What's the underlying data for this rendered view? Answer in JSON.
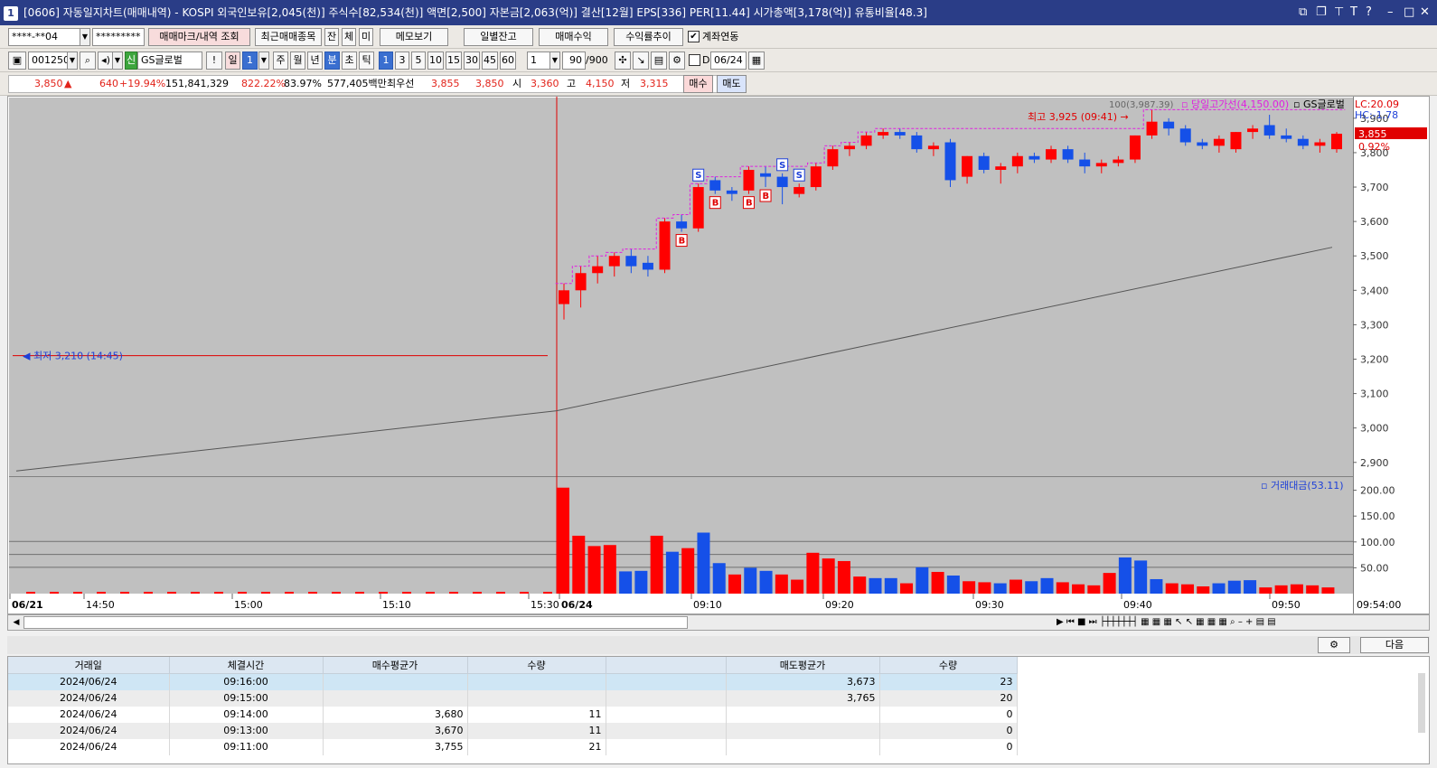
{
  "title": {
    "num": "1",
    "text": "[0606] 자동일지차트(매매내역) - KOSPI 외국인보유[2,045(천)] 주식수[82,534(천)] 액면[2,500] 자본금[2,063(억)] 결산[12월] EPS[336] PER[11.44] 시가총액[3,178(억)] 유통비율[48.3]"
  },
  "toolbar1": {
    "account": "****-**04",
    "password": "*********",
    "btn_mark": "매매마크/내역 조회",
    "btn_recent": "최근매매종목",
    "btn_jan": "잔",
    "btn_che": "체",
    "btn_mi": "미",
    "btn_memo": "메모보기",
    "btn_daily": "일별잔고",
    "btn_profit": "매매수익",
    "btn_rate": "수익률추이",
    "link_label": "계좌연동"
  },
  "toolbar2": {
    "code": "001250",
    "badge": "신",
    "name": "GS글로벌",
    "excl": "!",
    "day": "일",
    "day_num": "1",
    "periods": [
      "주",
      "월",
      "년",
      "분",
      "초",
      "틱"
    ],
    "intervals": [
      "1",
      "3",
      "5",
      "10",
      "15",
      "30",
      "45",
      "60"
    ],
    "interval_val": "1",
    "count": "90",
    "count_max": "/900",
    "date_chk": "D",
    "date": "06/24"
  },
  "quote": {
    "price": "3,850",
    "arrow": "▲",
    "change": "640",
    "change_pct": "+19.94%",
    "volume": "151,841,329",
    "vol_pct": "822.22%",
    "rate2": "83.97%",
    "amount": "577,405백만",
    "best_label": "최우선",
    "ask": "3,855",
    "bid": "3,850",
    "open_label": "시",
    "open": "3,360",
    "high_label": "고",
    "high": "4,150",
    "low_label": "저",
    "low": "3,315",
    "buy_btn": "매수",
    "sell_btn": "매도"
  },
  "chart_labels": {
    "legend_ma": "100(3,987.39)",
    "legend_high": "당일고가선(4,150.00)",
    "legend_name": "GS글로벌",
    "lc": "LC:20.09",
    "hc": "HC:-1.78",
    "last_price": "3,855",
    "last_pct": "0.92%",
    "low_note": "최저 3,210 (14:45)",
    "high_note": "최고 3,925 (09:41)",
    "vol_legend": "거래대금(53.11)",
    "time_end": "09:54:00"
  },
  "chart_data": {
    "type": "candlestick",
    "price_axis": {
      "ticks": [
        "3,900",
        "3,800",
        "3,700",
        "3,600",
        "3,500",
        "3,400",
        "3,300",
        "3,200",
        "3,100",
        "3,000",
        "2,900"
      ],
      "range": [
        2860,
        3960
      ]
    },
    "volume_axis": {
      "ticks": [
        "200.00",
        "150.00",
        "100.00",
        "50.00"
      ],
      "range": [
        0,
        215
      ]
    },
    "x_labels": [
      "06/21",
      "14:50",
      "15:00",
      "15:10",
      "15:30",
      "06/24",
      "09:10",
      "09:20",
      "09:30",
      "09:40",
      "09:50"
    ],
    "candles": [
      [
        3360,
        3420,
        3315,
        3400
      ],
      [
        3400,
        3470,
        3350,
        3450
      ],
      [
        3450,
        3500,
        3420,
        3470
      ],
      [
        3470,
        3510,
        3440,
        3500
      ],
      [
        3500,
        3520,
        3450,
        3470
      ],
      [
        3480,
        3500,
        3440,
        3460
      ],
      [
        3460,
        3610,
        3450,
        3600
      ],
      [
        3600,
        3620,
        3570,
        3580
      ],
      [
        3580,
        3710,
        3570,
        3700
      ],
      [
        3720,
        3730,
        3680,
        3690
      ],
      [
        3690,
        3700,
        3660,
        3680
      ],
      [
        3690,
        3760,
        3680,
        3750
      ],
      [
        3740,
        3760,
        3700,
        3730
      ],
      [
        3730,
        3740,
        3650,
        3700
      ],
      [
        3680,
        3710,
        3670,
        3700
      ],
      [
        3700,
        3770,
        3690,
        3760
      ],
      [
        3760,
        3820,
        3750,
        3810
      ],
      [
        3810,
        3830,
        3790,
        3820
      ],
      [
        3820,
        3860,
        3810,
        3850
      ],
      [
        3850,
        3870,
        3840,
        3860
      ],
      [
        3860,
        3870,
        3840,
        3850
      ],
      [
        3850,
        3860,
        3800,
        3810
      ],
      [
        3810,
        3830,
        3790,
        3820
      ],
      [
        3830,
        3840,
        3700,
        3720
      ],
      [
        3730,
        3790,
        3710,
        3790
      ],
      [
        3790,
        3800,
        3740,
        3750
      ],
      [
        3750,
        3770,
        3710,
        3760
      ],
      [
        3760,
        3800,
        3740,
        3790
      ],
      [
        3790,
        3800,
        3770,
        3780
      ],
      [
        3780,
        3820,
        3770,
        3810
      ],
      [
        3810,
        3820,
        3770,
        3780
      ],
      [
        3780,
        3800,
        3740,
        3760
      ],
      [
        3760,
        3780,
        3740,
        3770
      ],
      [
        3770,
        3790,
        3760,
        3780
      ],
      [
        3780,
        3850,
        3770,
        3850
      ],
      [
        3850,
        3925,
        3840,
        3890
      ],
      [
        3890,
        3900,
        3850,
        3870
      ],
      [
        3870,
        3880,
        3820,
        3830
      ],
      [
        3830,
        3840,
        3810,
        3820
      ],
      [
        3820,
        3850,
        3800,
        3840
      ],
      [
        3810,
        3860,
        3800,
        3860
      ],
      [
        3860,
        3880,
        3840,
        3870
      ],
      [
        3880,
        3910,
        3840,
        3850
      ],
      [
        3850,
        3870,
        3830,
        3840
      ],
      [
        3840,
        3850,
        3810,
        3820
      ],
      [
        3820,
        3840,
        3800,
        3830
      ],
      [
        3810,
        3860,
        3800,
        3855
      ]
    ],
    "volumes": [
      205,
      112,
      92,
      94,
      43,
      44,
      112,
      81,
      88,
      118,
      59,
      37,
      50,
      44,
      37,
      27,
      79,
      68,
      63,
      33,
      30,
      30,
      20,
      51,
      42,
      35,
      24,
      22,
      20,
      27,
      24,
      30,
      22,
      18,
      16,
      40,
      70,
      64,
      28,
      20,
      18,
      14,
      20,
      25,
      26,
      12,
      16,
      18,
      16,
      12
    ],
    "prev_day_low_line": 3210,
    "ma_line": [
      2875,
      3050,
      3525
    ],
    "marks": [
      {
        "i": 8,
        "type": "S"
      },
      {
        "i": 7,
        "type": "B"
      },
      {
        "i": 9,
        "type": "B"
      },
      {
        "i": 11,
        "type": "B"
      },
      {
        "i": 12,
        "type": "B"
      },
      {
        "i": 14,
        "type": "S"
      },
      {
        "i": 13,
        "type": "S"
      }
    ]
  },
  "colors": {
    "up": "#ff0000",
    "down": "#1550e8",
    "ma": "#555555",
    "highline": "#e020e0",
    "bg": "#c0c0c0"
  },
  "bottom": {
    "settings_icon": "gear-icon",
    "next_btn": "다음"
  },
  "table": {
    "headers": [
      "거래일",
      "체결시간",
      "매수평균가",
      "수량",
      "",
      "매도평균가",
      "수량"
    ],
    "rows": [
      [
        "2024/06/24",
        "09:16:00",
        "",
        "",
        "",
        "3,673",
        "23"
      ],
      [
        "2024/06/24",
        "09:15:00",
        "",
        "",
        "",
        "3,765",
        "20"
      ],
      [
        "2024/06/24",
        "09:14:00",
        "3,680",
        "11",
        "",
        "",
        "0"
      ],
      [
        "2024/06/24",
        "09:13:00",
        "3,670",
        "11",
        "",
        "",
        "0"
      ],
      [
        "2024/06/24",
        "09:11:00",
        "3,755",
        "21",
        "",
        "",
        "0"
      ]
    ]
  }
}
